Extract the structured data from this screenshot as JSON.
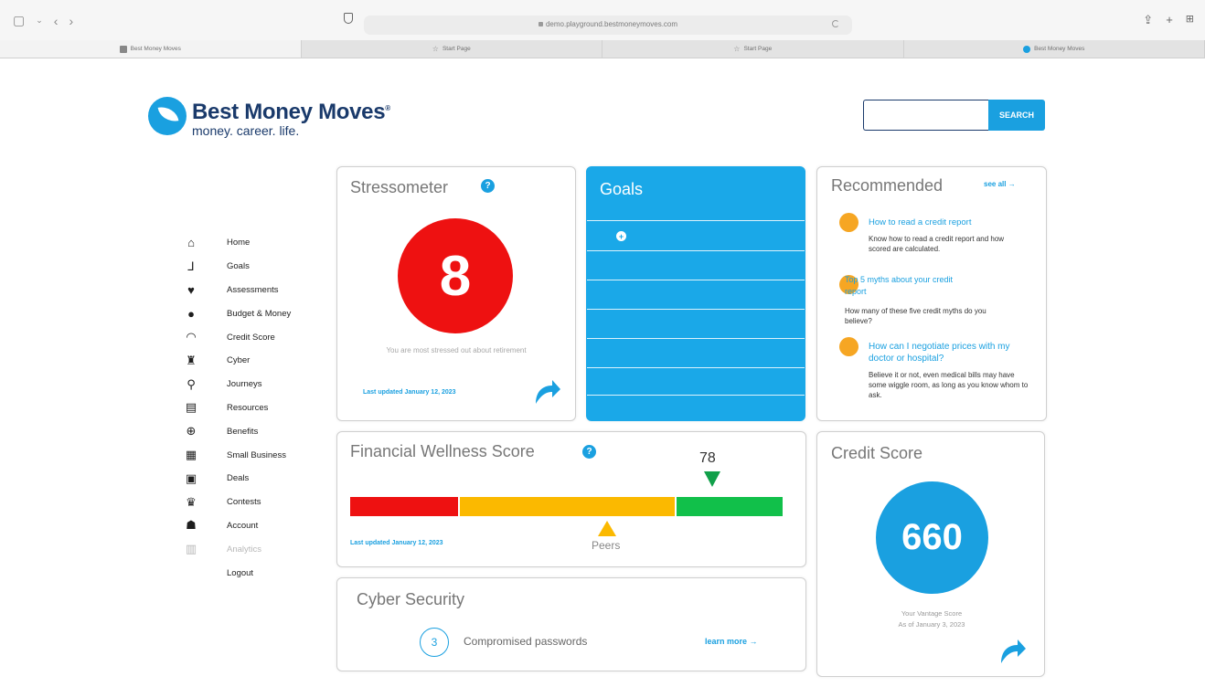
{
  "browser": {
    "url": "demo.playground.bestmoneymoves.com",
    "tabs": [
      "Best Money Moves",
      "Start Page",
      "Start Page",
      "Best Money Moves"
    ]
  },
  "brand": {
    "name": "Best Money Moves",
    "registered": "®",
    "tagline": "money. career. life."
  },
  "search": {
    "button_label": "SEARCH",
    "value": ""
  },
  "nav": {
    "items": [
      {
        "label": "Home",
        "icon": "home-icon",
        "glyph": "⌂"
      },
      {
        "label": "Goals",
        "icon": "goals-icon",
        "glyph": "⅃"
      },
      {
        "label": "Assessments",
        "icon": "heart-pulse-icon",
        "glyph": "♥"
      },
      {
        "label": "Budget & Money",
        "icon": "money-icon",
        "glyph": "●"
      },
      {
        "label": "Credit Score",
        "icon": "gauge-icon",
        "glyph": "◠"
      },
      {
        "label": "Cyber",
        "icon": "spy-icon",
        "glyph": "♜"
      },
      {
        "label": "Journeys",
        "icon": "map-pin-icon",
        "glyph": "⚲"
      },
      {
        "label": "Resources",
        "icon": "document-icon",
        "glyph": "▤"
      },
      {
        "label": "Benefits",
        "icon": "plus-circle-icon",
        "glyph": "⊕"
      },
      {
        "label": "Small Business",
        "icon": "store-icon",
        "glyph": "▦"
      },
      {
        "label": "Deals",
        "icon": "cash-icon",
        "glyph": "▣"
      },
      {
        "label": "Contests",
        "icon": "trophy-icon",
        "glyph": "♛"
      },
      {
        "label": "Account",
        "icon": "user-icon",
        "glyph": "☗"
      },
      {
        "label": "Analytics",
        "icon": "bar-chart-icon",
        "glyph": "▥"
      },
      {
        "label": "Logout",
        "icon": "",
        "glyph": ""
      }
    ]
  },
  "stressometer": {
    "title": "Stressometer",
    "score": "8",
    "description": "You are most stressed out about retirement",
    "updated": "Last updated January 12, 2023"
  },
  "goals": {
    "title": "Goals",
    "add_icon": "+"
  },
  "recommended": {
    "title": "Recommended",
    "see_all": "see all",
    "items": [
      {
        "title": "How to read a credit report",
        "description": "Know how to read a credit report and how scored are calculated."
      },
      {
        "title": "Top 5 myths about your credit report",
        "description": "How many of these five credit myths do you believe?"
      },
      {
        "title": "How can I negotiate prices with my doctor or hospital?",
        "description": "Believe it or not, even medical bills may have some wiggle room, as long as you know whom to ask."
      }
    ]
  },
  "financial_wellness": {
    "title": "Financial Wellness Score",
    "score": "78",
    "peers_label": "Peers",
    "updated": "Last updated January 12, 2023",
    "segments": [
      {
        "color": "#ee1111",
        "from": 0,
        "to": 25
      },
      {
        "color": "#fbb900",
        "from": 25,
        "to": 75
      },
      {
        "color": "#11c04a",
        "from": 75,
        "to": 100
      }
    ],
    "score_value": 78,
    "peers_value": 60
  },
  "cyber": {
    "title": "Cyber Security",
    "count": "3",
    "label": "Compromised passwords",
    "link": "learn more"
  },
  "credit": {
    "title": "Credit Score",
    "score": "660",
    "line1": "Your Vantage Score",
    "line2": "As of January 3, 2023"
  },
  "colors": {
    "accent": "#1aa0e0",
    "brand_dark": "#1a3a6b",
    "stress": "#ee1111",
    "recommend_dot": "#f6a623"
  }
}
